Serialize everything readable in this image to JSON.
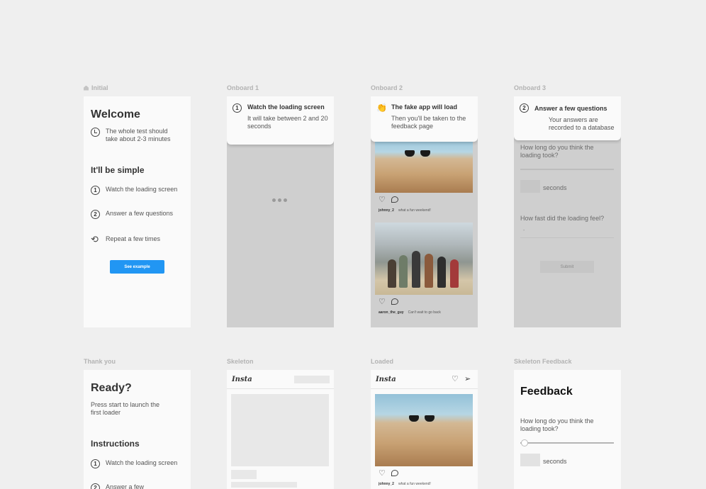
{
  "frames": {
    "initial": {
      "label": "Initial",
      "title": "Welcome",
      "intro": "The whole test should take about 2-3 minutes",
      "subtitle": "It'll be simple",
      "steps": [
        {
          "num": "1",
          "text": "Watch the loading screen"
        },
        {
          "num": "2",
          "text": "Answer a few questions"
        },
        {
          "text": "Repeat a few times"
        }
      ],
      "button": "See example"
    },
    "onboard1": {
      "label": "Onboard 1",
      "num": "1",
      "title": "Watch the loading screen",
      "sub": "It will take between 2 and 20 seconds"
    },
    "onboard2": {
      "label": "Onboard 2",
      "title": "The fake app will load",
      "sub": "Then you'll be taken to the feedback page",
      "posts": [
        {
          "user": "johnny_2",
          "caption": "what a fun weekend!"
        },
        {
          "user": "aaron_the_guy",
          "caption": "Can't wait to go back"
        }
      ]
    },
    "onboard3": {
      "label": "Onboard 3",
      "num": "2",
      "title": "Answer a few questions",
      "sub": "Your answers are recorded to a database",
      "q1": "How long do you think the loading took?",
      "unit": "seconds",
      "q2": "How fast did the loading feel?",
      "select_value": "-",
      "submit": "Submit"
    },
    "thankyou": {
      "label": "Thank you",
      "title": "Ready?",
      "intro": "Press start to launch the first loader",
      "subtitle": "Instructions",
      "steps": [
        {
          "num": "1",
          "text": "Watch the loading screen"
        },
        {
          "num": "2",
          "text": "Answer a few"
        }
      ]
    },
    "skeleton": {
      "label": "Skeleton",
      "logo": "Insta"
    },
    "loaded": {
      "label": "Loaded",
      "logo": "Insta",
      "post": {
        "user": "johnny_2",
        "caption": "what a fun weekend!"
      }
    },
    "feedback": {
      "label": "Skeleton Feedback",
      "title": "Feedback",
      "q1": "How long do you think the loading took?",
      "unit": "seconds"
    }
  },
  "icons": {
    "home": "home-icon",
    "clock": "clock-icon",
    "repeat": "repeat-icon",
    "clap": "clapping-hands-icon",
    "heart": "heart-icon",
    "comment": "comment-icon",
    "send": "send-icon"
  },
  "colors": {
    "background": "#efefef",
    "frame": "#fafafa",
    "overlay": "#cfcfcf",
    "accent": "#2196f3"
  }
}
